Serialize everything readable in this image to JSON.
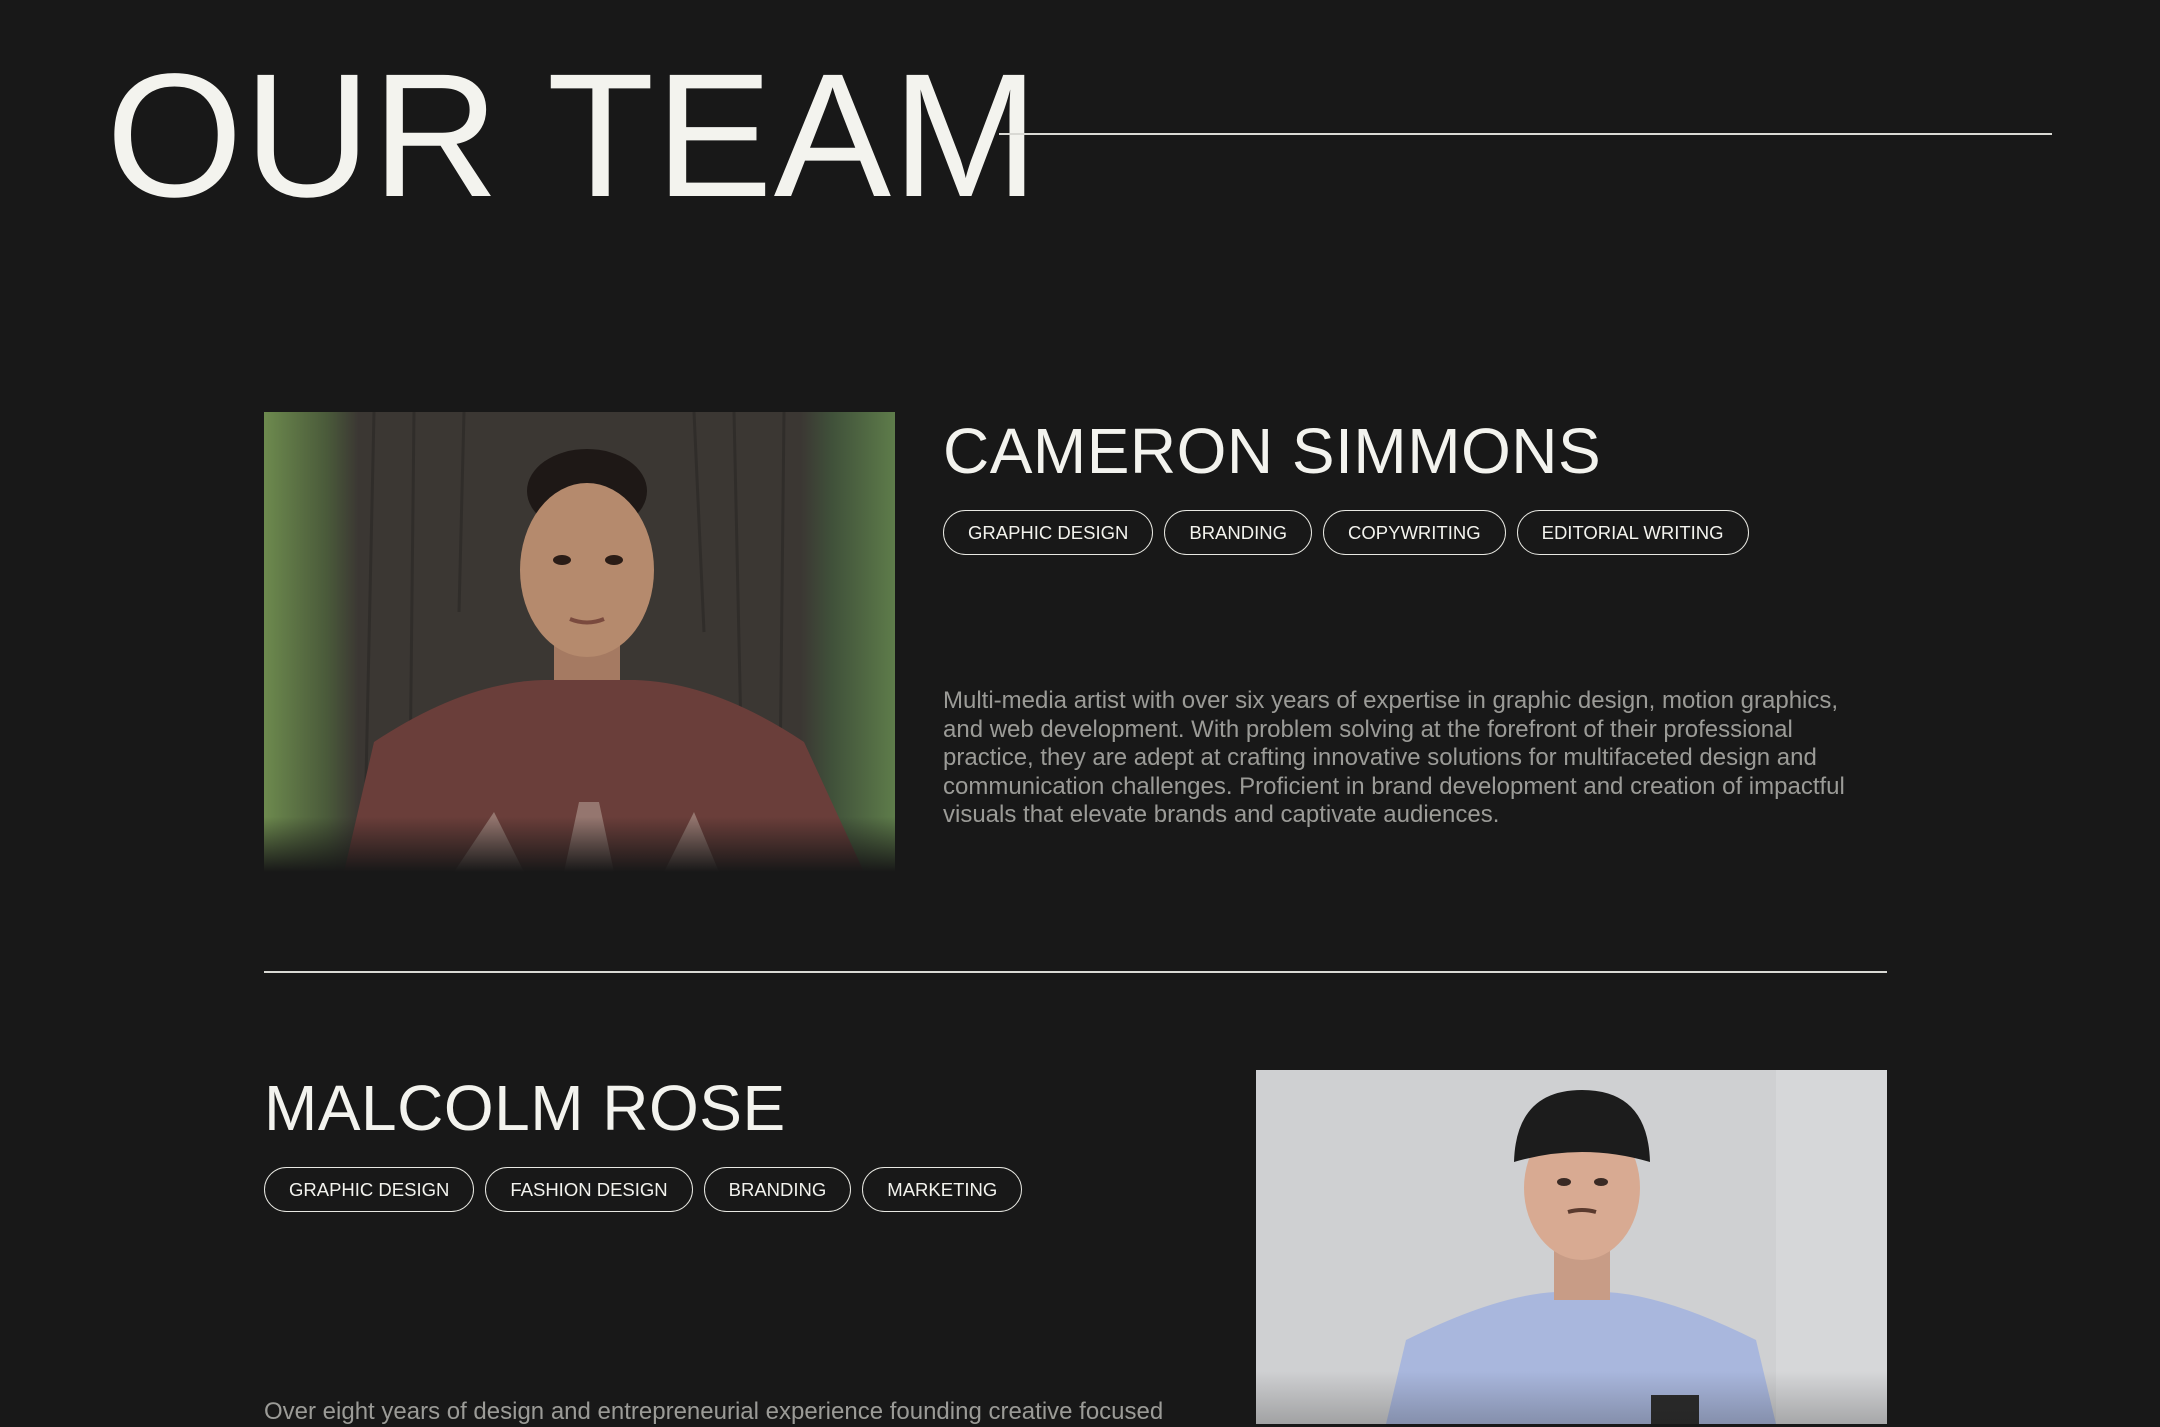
{
  "header": {
    "title": "OUR TEAM"
  },
  "members": [
    {
      "name": "CAMERON SIMMONS",
      "tags": [
        "GRAPHIC DESIGN",
        "BRANDING",
        "COPYWRITING",
        "EDITORIAL WRITING"
      ],
      "bio": "Multi-media artist with over six years of expertise in graphic design, motion graphics, and web development. With problem solving at the forefront of their professional practice, they are adept at crafting innovative solutions for multifaceted design and communication challenges. Proficient in brand development and creation of impactful visuals that elevate brands and captivate audiences."
    },
    {
      "name": "MALCOLM ROSE",
      "tags": [
        "GRAPHIC DESIGN",
        "FASHION DESIGN",
        "BRANDING",
        "MARKETING"
      ],
      "bio": "Over eight years of design and entrepreneurial experience founding creative focused"
    }
  ],
  "colors": {
    "background": "#181818",
    "text": "#f3f3ee",
    "muted": "#9b9b97"
  }
}
